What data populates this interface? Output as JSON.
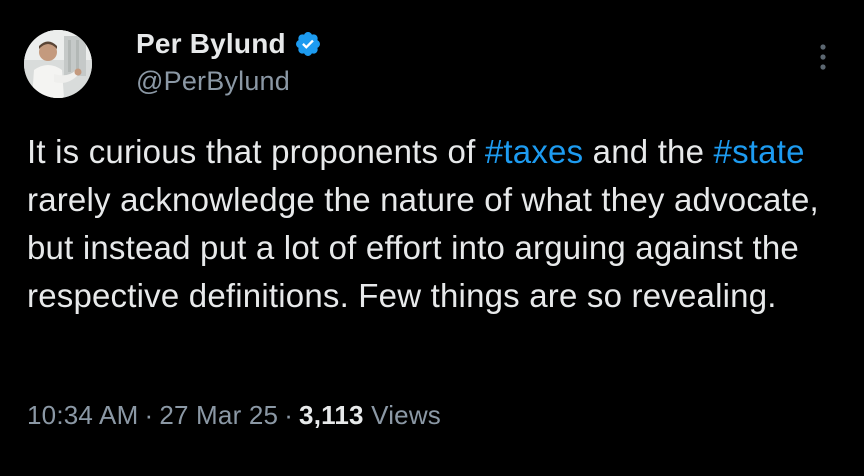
{
  "author": {
    "display_name": "Per Bylund",
    "handle": "@PerBylund",
    "verified": true,
    "avatar_icon": "profile-photo"
  },
  "tweet": {
    "segments": [
      {
        "text": "It is curious that proponents of ",
        "type": "text"
      },
      {
        "text": "#taxes",
        "type": "hashtag"
      },
      {
        "text": " and the ",
        "type": "text"
      },
      {
        "text": "#state",
        "type": "hashtag"
      },
      {
        "text": " rarely acknowledge the nature of what they advocate, but instead put a lot of effort into arguing against the respective definitions. Few things are so revealing.",
        "type": "text"
      }
    ]
  },
  "meta": {
    "time": "10:34 AM",
    "separator": "·",
    "date": "27 Mar 25",
    "views_count": "3,113",
    "views_label": "Views"
  },
  "colors": {
    "background": "#000000",
    "text": "#e7e9ea",
    "secondary": "#8b98a5",
    "accent": "#1d9bf0"
  }
}
